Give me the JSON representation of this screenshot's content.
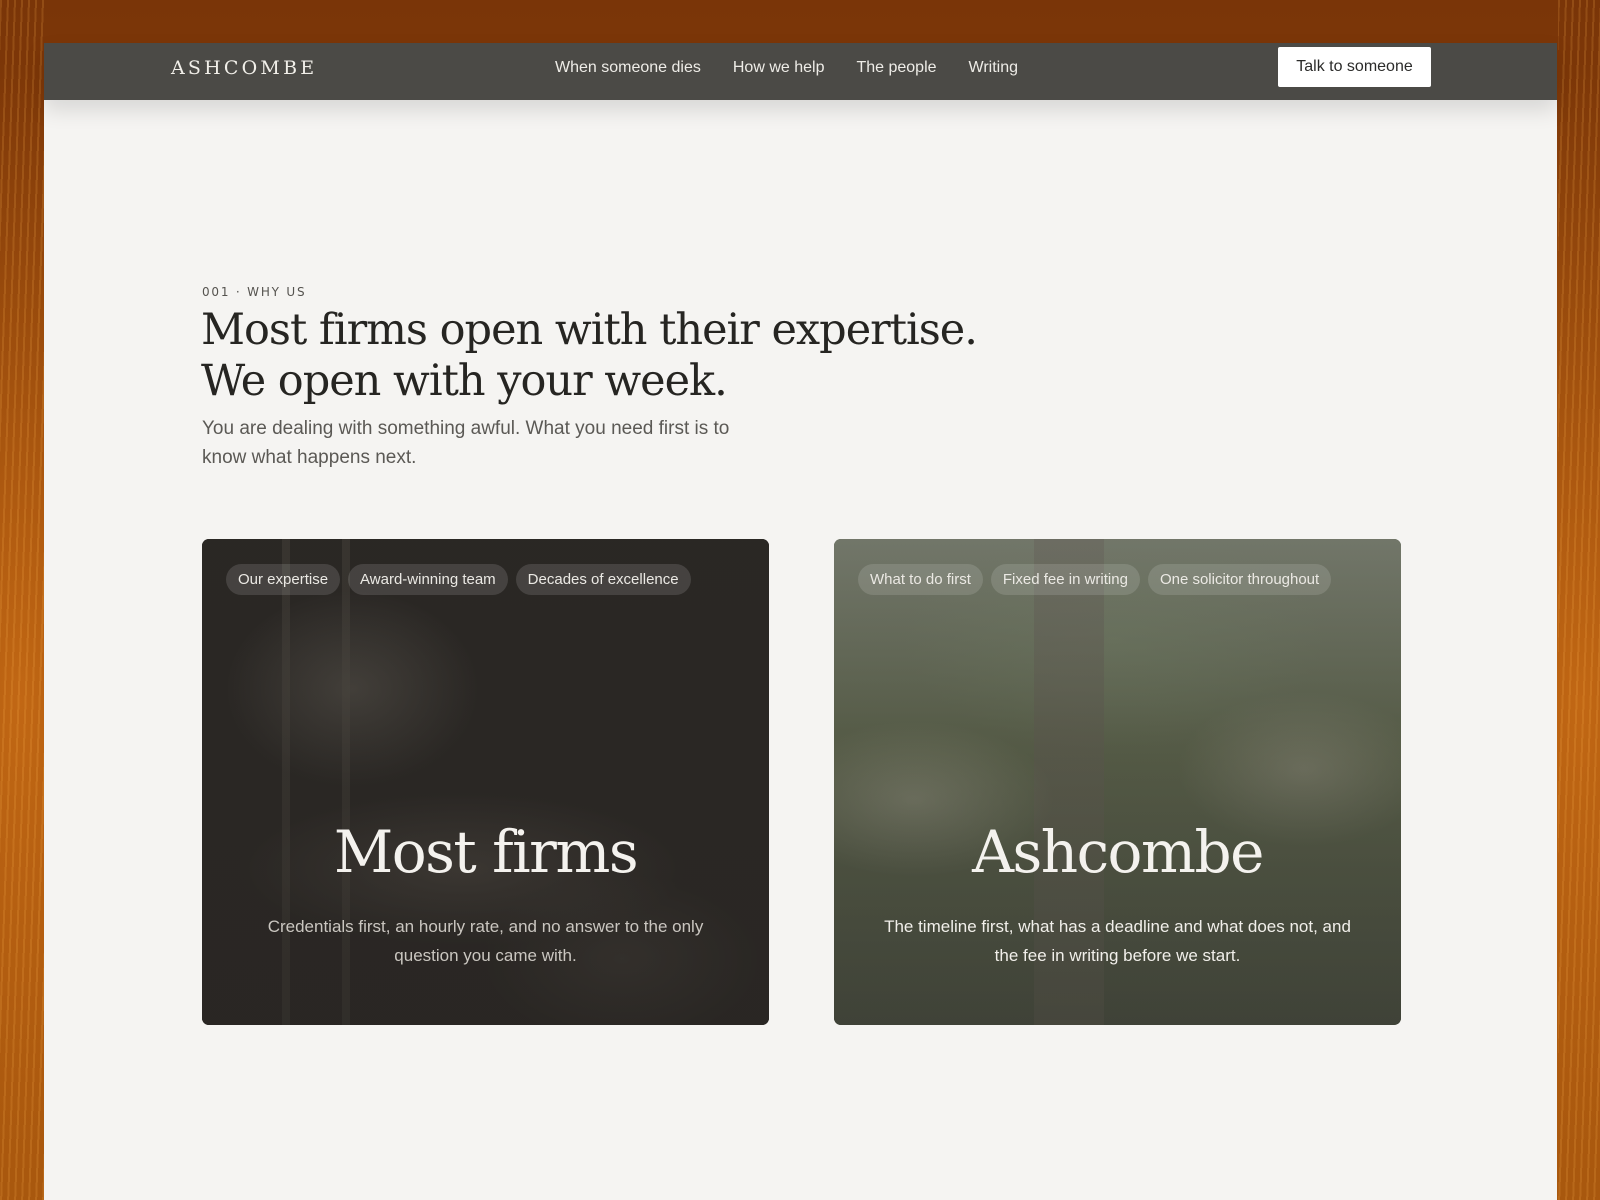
{
  "nav": {
    "logo": "ASHCOMBE",
    "links": [
      "When someone dies",
      "How we help",
      "The people",
      "Writing"
    ],
    "cta_label": "Talk to someone"
  },
  "section": {
    "eyebrow": "001 · WHY US",
    "headline": "Most firms open with their expertise. We open with your week.",
    "subhead": "You are dealing with something awful. What you need first is to know what happens next."
  },
  "cards": [
    {
      "chips": [
        "Our expertise",
        "Award-winning team",
        "Decades of excellence"
      ],
      "title": "Most firms",
      "text": "Credentials first, an hourly rate, and no answer to the only question you came with."
    },
    {
      "chips": [
        "What to do first",
        "Fixed fee in writing",
        "One solicitor throughout"
      ],
      "title": "Ashcombe",
      "text": "The timeline first, what has a deadline and what does not, and the fee in writing before we start."
    }
  ],
  "colors": {
    "nav_background": "#4b4a46",
    "page_background": "#f5f4f2",
    "backdrop_orange": "#a0520c"
  }
}
